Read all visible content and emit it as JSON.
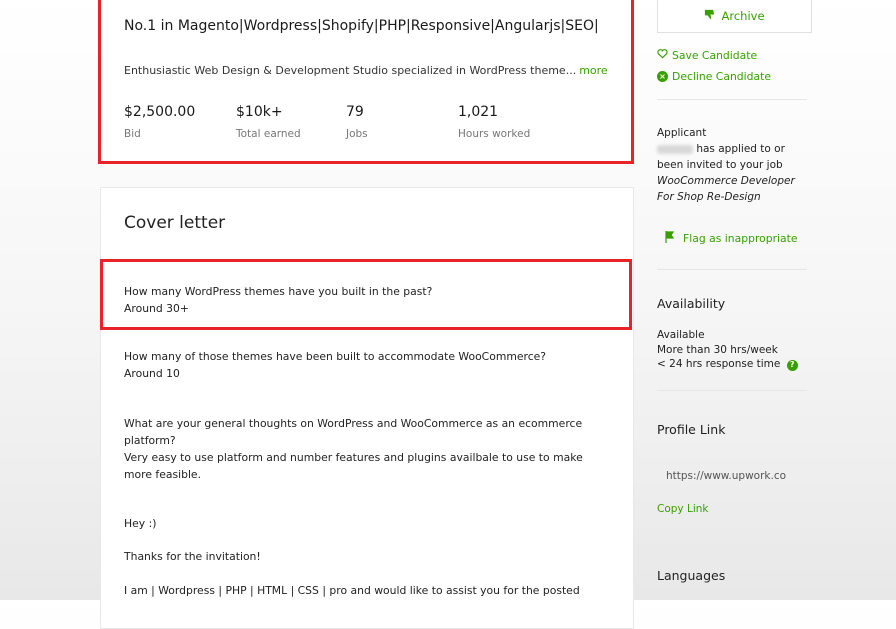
{
  "profile": {
    "headline": "No.1 in Magento|Wordpress|Shopify|PHP|Responsive|Angularjs|SEO|",
    "description": "Enthusiastic Web Design & Development Studio specialized in WordPress theme...",
    "more_label": "more",
    "stats": [
      {
        "value": "$2,500.00",
        "label": "Bid"
      },
      {
        "value": "$10k+",
        "label": "Total earned"
      },
      {
        "value": "79",
        "label": "Jobs"
      },
      {
        "value": "1,021",
        "label": "Hours worked"
      }
    ]
  },
  "cover_letter": {
    "title": "Cover letter",
    "qa": [
      {
        "q": "How many WordPress themes have you built in the past?",
        "a": "Around 30+"
      },
      {
        "q": "How many of those themes have been built to accommodate WooCommerce?",
        "a": "Around 10"
      },
      {
        "q": "What are your general thoughts on WordPress and WooCommerce as an ecommerce platform?",
        "a": "Very easy to use platform and number features and plugins availbale to use to make more feasible."
      }
    ],
    "greeting": "Hey :)",
    "thanks": "Thanks for the invitation!",
    "body_line": "I am | Wordpress | PHP | HTML | CSS | pro and would like to assist you for the posted"
  },
  "sidebar": {
    "archive_label": "Archive",
    "save_label": "Save Candidate",
    "decline_label": "Decline Candidate",
    "applicant_heading": "Applicant",
    "applicant_text_1": "has applied to or been invited to your job",
    "job_title": "WooCommerce Developer For Shop Re-Design",
    "flag_label": "Flag as inappropriate",
    "availability_heading": "Availability",
    "availability_status": "Available",
    "availability_hours": "More than 30 hrs/week",
    "availability_response": "< 24 hrs response time",
    "profile_link_heading": "Profile Link",
    "profile_link_value": "https://www.upwork.co",
    "copy_link_label": "Copy Link",
    "languages_heading": "Languages"
  },
  "colors": {
    "accent": "#37a000",
    "highlight": "#e8232a"
  }
}
